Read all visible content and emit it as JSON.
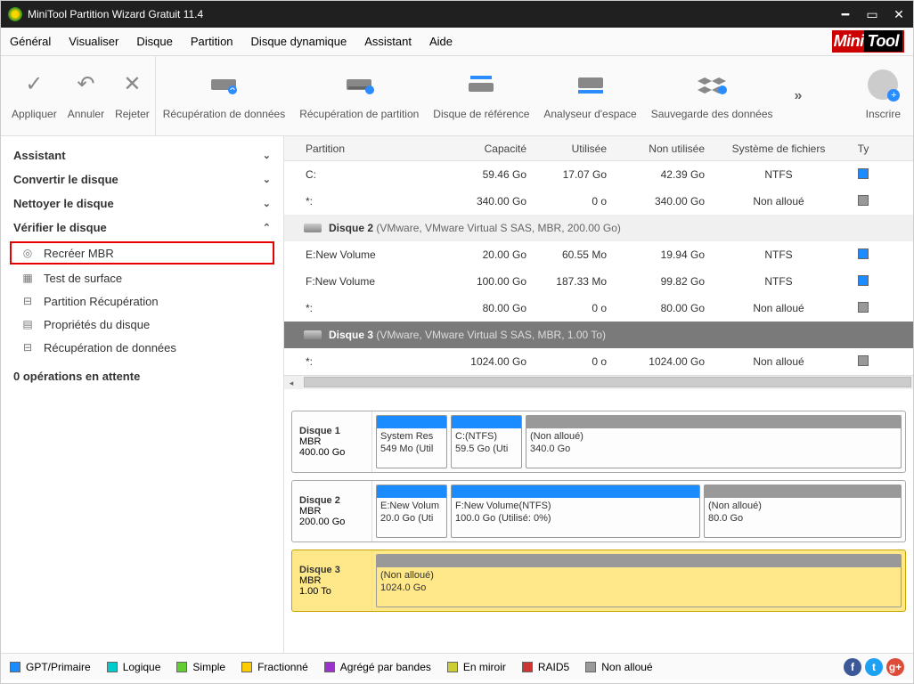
{
  "window": {
    "title": "MiniTool Partition Wizard Gratuit 11.4"
  },
  "menu": {
    "general": "Général",
    "view": "Visualiser",
    "disk": "Disque",
    "partition": "Partition",
    "dynamic": "Disque dynamique",
    "assistant": "Assistant",
    "help": "Aide",
    "logo1": "Mini",
    "logo2": "Tool"
  },
  "toolbar": {
    "apply": "Appliquer",
    "undo": "Annuler",
    "discard": "Rejeter",
    "data_recovery": "Récupération de données",
    "partition_recovery": "Récupération de partition",
    "benchmark": "Disque de référence",
    "space_analyzer": "Analyseur d'espace",
    "backup": "Sauvegarde des données",
    "more": "»",
    "register": "Inscrire"
  },
  "sidebar": {
    "cats": {
      "assistant": "Assistant",
      "convert": "Convertir le disque",
      "clean": "Nettoyer le disque",
      "check": "Vérifier le disque"
    },
    "items": {
      "rebuild_mbr": "Recréer MBR",
      "surface_test": "Test de surface",
      "partition_recovery": "Partition Récupération",
      "disk_props": "Propriétés du disque",
      "data_recovery": "Récupération de données"
    },
    "pending": "0 opérations en attente"
  },
  "grid": {
    "headers": {
      "partition": "Partition",
      "capacity": "Capacité",
      "used": "Utilisée",
      "unused": "Non utilisée",
      "fs": "Système de fichiers",
      "type": "Ty"
    },
    "rows": [
      {
        "part": "C:",
        "cap": "59.46 Go",
        "used": "17.07 Go",
        "unused": "42.39 Go",
        "fs": "NTFS",
        "swatch": "sw-blue"
      },
      {
        "part": "*:",
        "cap": "340.00 Go",
        "used": "0 o",
        "unused": "340.00 Go",
        "fs": "Non alloué",
        "swatch": "sw-gray"
      }
    ],
    "disk2": {
      "name": "Disque 2",
      "info": "(VMware, VMware Virtual S SAS, MBR, 200.00 Go)"
    },
    "rows2": [
      {
        "part": "E:New Volume",
        "cap": "20.00 Go",
        "used": "60.55 Mo",
        "unused": "19.94 Go",
        "fs": "NTFS",
        "swatch": "sw-blue"
      },
      {
        "part": "F:New Volume",
        "cap": "100.00 Go",
        "used": "187.33 Mo",
        "unused": "99.82 Go",
        "fs": "NTFS",
        "swatch": "sw-blue"
      },
      {
        "part": "*:",
        "cap": "80.00 Go",
        "used": "0 o",
        "unused": "80.00 Go",
        "fs": "Non alloué",
        "swatch": "sw-gray"
      }
    ],
    "disk3": {
      "name": "Disque 3",
      "info": "(VMware, VMware Virtual S SAS, MBR, 1.00 To)"
    },
    "rows3": [
      {
        "part": "*:",
        "cap": "1024.00 Go",
        "used": "0 o",
        "unused": "1024.00 Go",
        "fs": "Non alloué",
        "swatch": "sw-gray"
      }
    ]
  },
  "diskmap": {
    "d1": {
      "name": "Disque 1",
      "type": "MBR",
      "size": "400.00 Go",
      "p1": {
        "label": "System Res",
        "sub": "549 Mo (Util"
      },
      "p2": {
        "label": "C:(NTFS)",
        "sub": "59.5 Go (Uti"
      },
      "p3": {
        "label": "(Non alloué)",
        "sub": "340.0 Go"
      }
    },
    "d2": {
      "name": "Disque 2",
      "type": "MBR",
      "size": "200.00 Go",
      "p1": {
        "label": "E:New Volum",
        "sub": "20.0 Go (Uti"
      },
      "p2": {
        "label": "F:New Volume(NTFS)",
        "sub": "100.0 Go (Utilisé: 0%)"
      },
      "p3": {
        "label": "(Non alloué)",
        "sub": "80.0 Go"
      }
    },
    "d3": {
      "name": "Disque 3",
      "type": "MBR",
      "size": "1.00 To",
      "p1": {
        "label": "(Non alloué)",
        "sub": "1024.0 Go"
      }
    }
  },
  "legend": {
    "gpt": "GPT/Primaire",
    "logical": "Logique",
    "simple": "Simple",
    "spanned": "Fractionné",
    "striped": "Agrégé par bandes",
    "mirrored": "En miroir",
    "raid5": "RAID5",
    "unalloc": "Non alloué"
  }
}
